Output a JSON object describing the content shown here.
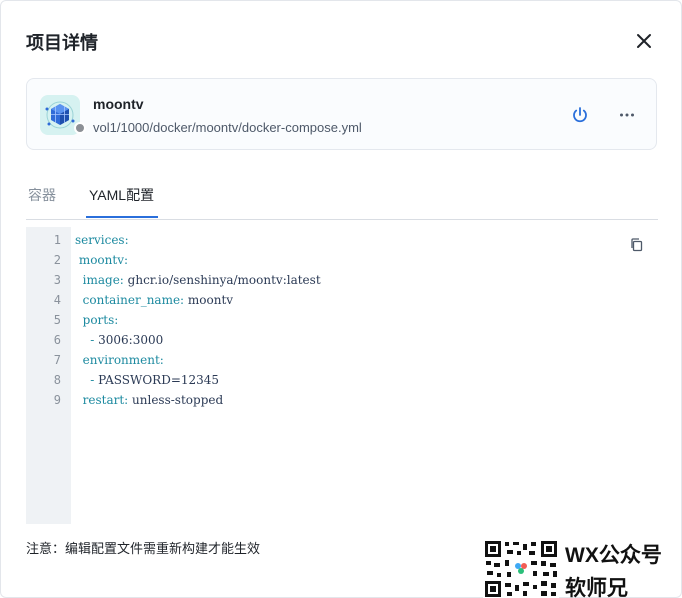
{
  "dialog": {
    "title": "项目详情",
    "close_icon": "close-icon"
  },
  "project": {
    "name": "moontv",
    "path": "vol1/1000/docker/moontv/docker-compose.yml",
    "status_color": "#8c9096",
    "icon": "docker-cube-icon",
    "power_icon": "power-icon",
    "more_icon": "more-horizontal-icon"
  },
  "tabs": [
    {
      "label": "容器",
      "active": false
    },
    {
      "label": "YAML配置",
      "active": true
    }
  ],
  "editor": {
    "copy_icon": "copy-icon",
    "lines": [
      {
        "num": "1",
        "indent": "",
        "key": "services:",
        "val": ""
      },
      {
        "num": "2",
        "indent": " ",
        "key": "moontv:",
        "val": ""
      },
      {
        "num": "3",
        "indent": "  ",
        "key": "image:",
        "val": " ghcr.io/senshinya/moontv:latest"
      },
      {
        "num": "4",
        "indent": "  ",
        "key": "container_name:",
        "val": " moontv"
      },
      {
        "num": "5",
        "indent": "  ",
        "key": "ports:",
        "val": ""
      },
      {
        "num": "6",
        "indent": "    ",
        "key": "- ",
        "val": "3006:3000"
      },
      {
        "num": "7",
        "indent": "  ",
        "key": "environment:",
        "val": ""
      },
      {
        "num": "8",
        "indent": "    ",
        "key": "- ",
        "val": "PASSWORD=12345"
      },
      {
        "num": "9",
        "indent": "  ",
        "key": "restart:",
        "val": " unless-stopped"
      }
    ]
  },
  "note": "注意：编辑配置文件需重新构建才能生效",
  "watermark": {
    "line1": "WX公众号",
    "line2": "软师兄"
  },
  "colors": {
    "accent": "#2a6fdb",
    "yaml_key": "#1d8aa0",
    "yaml_value": "#2b3a55"
  }
}
